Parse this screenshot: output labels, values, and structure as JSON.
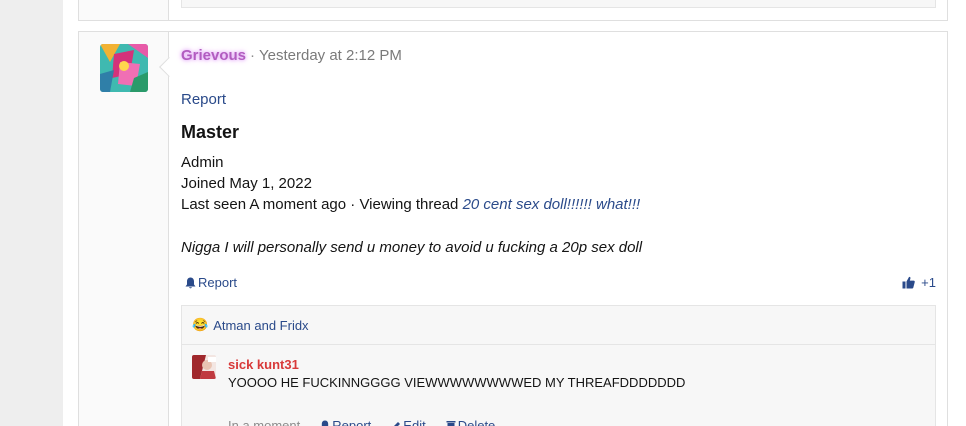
{
  "post": {
    "author": "Grievous",
    "separator": "·",
    "timestamp": "Yesterday at 2:12 PM",
    "report_label": "Report",
    "rank": "Master",
    "role": "Admin",
    "joined": "Joined May 1, 2022",
    "last_seen_prefix": "Last seen A moment ago · Viewing thread",
    "last_seen_thread": "20 cent sex doll!!!!!! what!!!",
    "message": "Nigga I will personally send u money to avoid u fucking a 20p sex doll",
    "actions": {
      "report_label": "Report",
      "like_count": "+1"
    },
    "reactions": {
      "emoji": "😂",
      "label": "Atman and Fridx"
    }
  },
  "comment": {
    "author": "sick kunt31",
    "text": "YOOOO HE FUCKINNGGGG VIEWWWWWWWWED MY THREAFDDDDDDD",
    "time": "In a moment",
    "report_label": "Report",
    "edit_label": "Edit",
    "delete_label": "Delete"
  },
  "icons": {
    "bell": "bell-icon",
    "thumbs_up": "thumbs-up-icon",
    "pencil": "pencil-icon",
    "trash": "trash-icon"
  },
  "colors": {
    "link": "#2a4a8a",
    "username_glow": "#b25cc0",
    "comment_author": "#d83a3a"
  }
}
